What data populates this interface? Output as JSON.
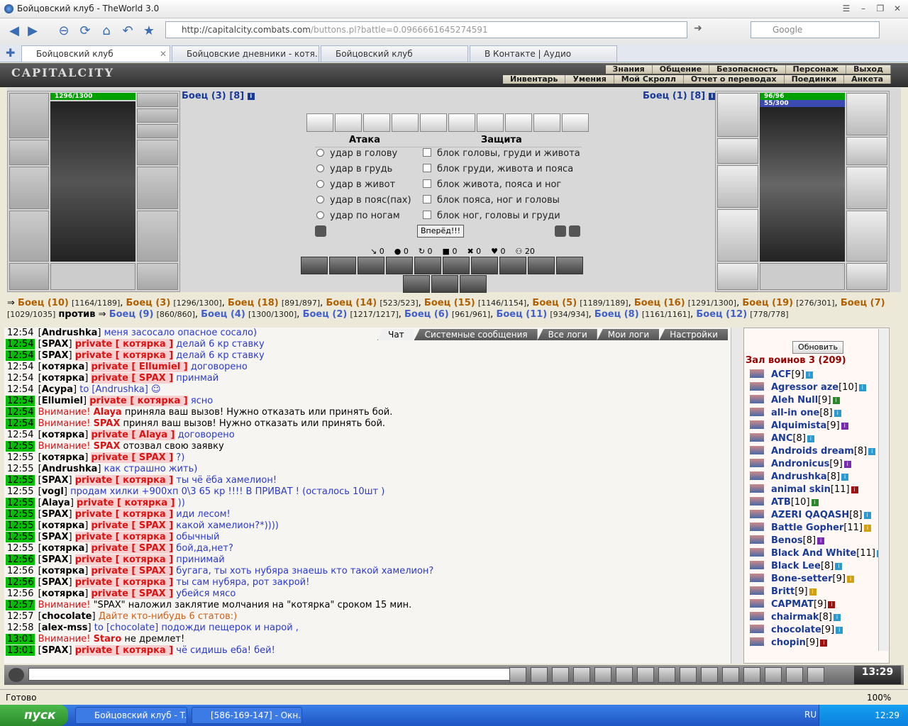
{
  "window": {
    "title": "Бойцовский клуб - TheWorld 3.0"
  },
  "address": {
    "host": "http://capitalcity.combats.com",
    "path": "/buttons.pl?battle=0.0966661645274591"
  },
  "search": {
    "placeholder": "Google"
  },
  "tabs": [
    {
      "label": "Бойцовский клуб"
    },
    {
      "label": "Бойцовские дневники - котя..."
    },
    {
      "label": "Бойцовский клуб"
    },
    {
      "label": "В Контакте | Аудио"
    }
  ],
  "site": {
    "logo": "CAPITALCITY",
    "menu_top": [
      "Знания",
      "Общение",
      "Безопасность",
      "Персонаж",
      "Выход"
    ],
    "menu_bottom": [
      "Инвентарь",
      "Умения",
      "Мой Скролл",
      "Отчет о переводах",
      "Поединки",
      "Анкета"
    ]
  },
  "battle": {
    "left": {
      "name": "Боец (3) [8]",
      "hp": "1296/1300"
    },
    "right": {
      "name": "Боец (1) [8]",
      "hp": "96/96",
      "mana": "55/300"
    },
    "attack_title": "Атака",
    "defense_title": "Защита",
    "attacks": [
      "удар в голову",
      "удар в грудь",
      "удар в живот",
      "удар в пояс(пах)",
      "удар по ногам"
    ],
    "blocks": [
      "блок головы, груди и живота",
      "блок груди, живота и пояса",
      "блок живота, пояса и ног",
      "блок пояса, ног и головы",
      "блок ног, головы и груди"
    ],
    "go_button": "Вперёд!!!",
    "counters": [
      "0",
      "0",
      "0",
      "0",
      "0",
      "0",
      "20"
    ],
    "versus": "против"
  },
  "team_a": [
    [
      "Боец (10)",
      "[1164/1189]"
    ],
    [
      "Боец (3)",
      "[1296/1300]"
    ],
    [
      "Боец (18)",
      "[891/897]"
    ],
    [
      "Боец (14)",
      "[523/523]"
    ],
    [
      "Боец (15)",
      "[1146/1154]"
    ],
    [
      "Боец (5)",
      "[1189/1189]"
    ],
    [
      "Боец (16)",
      "[1291/1300]"
    ],
    [
      "Боец (19)",
      "[276/301]"
    ],
    [
      "Боец (7)",
      "[1029/1035]"
    ]
  ],
  "team_b": [
    [
      "Боец (9)",
      "[860/860]"
    ],
    [
      "Боец (4)",
      "[1300/1300]"
    ],
    [
      "Боец (2)",
      "[1217/1217]"
    ],
    [
      "Боец (6)",
      "[961/961]"
    ],
    [
      "Боец (11)",
      "[934/934]"
    ],
    [
      "Боец (8)",
      "[1161/1161]"
    ],
    [
      "Боец (12)",
      "[778/778]"
    ]
  ],
  "chat_tabs": [
    "Чат",
    "Системные сообщения",
    "Все логи",
    "Мои логи",
    "Настройки"
  ],
  "chat": [
    {
      "t": "12:54",
      "g": false,
      "nick": "Andrushka",
      "pv": "",
      "msg": "меня засосало опасное сосало)",
      "mc": "ms"
    },
    {
      "t": "12:54",
      "g": true,
      "nick": "SPAX",
      "pv": "private [ котярка ]",
      "msg": "делай 6 кр ставку",
      "mc": "ms"
    },
    {
      "t": "12:54",
      "g": true,
      "nick": "SPAX",
      "pv": "private [ котярка ]",
      "msg": "делай 6 кр ставку",
      "mc": "ms"
    },
    {
      "t": "12:54",
      "g": false,
      "nick": "котярка",
      "pv": "private [ Ellumiel ]",
      "msg": "договорено",
      "mc": "ms"
    },
    {
      "t": "12:54",
      "g": false,
      "nick": "котярка",
      "pv": "private [ SPAX ]",
      "msg": "принмай",
      "mc": "ms"
    },
    {
      "t": "12:54",
      "g": false,
      "nick": "Acypa",
      "pv": "",
      "msg": "to [Andrushka] ☺",
      "mc": "ms"
    },
    {
      "t": "12:54",
      "g": true,
      "nick": "Ellumiel",
      "pv": "private [ котярка ]",
      "msg": "ясно",
      "mc": "ms"
    },
    {
      "t": "12:54",
      "g": true,
      "warn": "Внимание!",
      "who": "Alaya",
      "text": "приняла ваш вызов! Нужно отказать или принять бой."
    },
    {
      "t": "12:54",
      "g": true,
      "warn": "Внимание!",
      "who": "SPAX",
      "text": "принял ваш вызов! Нужно отказать или принять бой."
    },
    {
      "t": "12:54",
      "g": false,
      "nick": "котярка",
      "pv": "private [ Alaya ]",
      "msg": "договорено",
      "mc": "ms"
    },
    {
      "t": "12:55",
      "g": true,
      "warn": "Внимание!",
      "who": "SPAX",
      "text": "отозвал свою заявку"
    },
    {
      "t": "12:55",
      "g": false,
      "nick": "котярка",
      "pv": "private [ SPAX ]",
      "msg": "?)",
      "mc": "ms"
    },
    {
      "t": "12:55",
      "g": false,
      "nick": "Andrushka",
      "pv": "",
      "msg": "как страшно жить)",
      "mc": "ms"
    },
    {
      "t": "12:55",
      "g": true,
      "nick": "SPAX",
      "pv": "private [ котярка ]",
      "msg": "ты чё ёба хамелион!",
      "mc": "ms"
    },
    {
      "t": "12:55",
      "g": false,
      "nick": "vogl",
      "pv": "",
      "msg": "продам хилки +900хп 0\\3 65 кр !!!! В ПРИВАТ ! (осталось 10шт )",
      "mc": "ms"
    },
    {
      "t": "12:55",
      "g": true,
      "nick": "Alaya",
      "pv": "private [ котярка ]",
      "msg": "))",
      "mc": "ms"
    },
    {
      "t": "12:55",
      "g": true,
      "nick": "SPAX",
      "pv": "private [ котярка ]",
      "msg": "иди лесом!",
      "mc": "ms"
    },
    {
      "t": "12:55",
      "g": true,
      "nick": "котярка",
      "pv": "private [ SPAX ]",
      "msg": "какой хамелион?*))))",
      "mc": "ms"
    },
    {
      "t": "12:55",
      "g": true,
      "nick": "SPAX",
      "pv": "private [ котярка ]",
      "msg": "обычный",
      "mc": "ms"
    },
    {
      "t": "12:55",
      "g": false,
      "nick": "котярка",
      "pv": "private [ SPAX ]",
      "msg": "бой,да,нет?",
      "mc": "ms"
    },
    {
      "t": "12:56",
      "g": true,
      "nick": "SPAX",
      "pv": "private [ котярка ]",
      "msg": "принимай",
      "mc": "ms"
    },
    {
      "t": "12:56",
      "g": false,
      "nick": "котярка",
      "pv": "private [ SPAX ]",
      "msg": "бугага, ты хоть нубяра знаешь кто такой хамелион?",
      "mc": "ms"
    },
    {
      "t": "12:56",
      "g": true,
      "nick": "SPAX",
      "pv": "private [ котярка ]",
      "msg": "ты сам нубяра, рот закрой!",
      "mc": "ms"
    },
    {
      "t": "12:56",
      "g": false,
      "nick": "котярка",
      "pv": "private [ SPAX ]",
      "msg": "убейся мясо",
      "mc": "ms"
    },
    {
      "t": "12:57",
      "g": true,
      "warn": "Внимание!",
      "who": "",
      "text": "\"SPAX\" наложил заклятие молчания на \"котярка\" сроком 15 мин."
    },
    {
      "t": "12:57",
      "g": false,
      "nick": "chocolate",
      "pv": "",
      "msg": "Дайте кто-нибудь 6 статов:)",
      "mc": "ann"
    },
    {
      "t": "12:58",
      "g": false,
      "nick": "alex-mss",
      "pv": "",
      "msg": "to [chocolate] подожди пещерок и нарой ,",
      "mc": "ms"
    },
    {
      "t": "13:01",
      "g": true,
      "warn": "Внимание!",
      "who": "Staro",
      "text": "не дремлет!"
    },
    {
      "t": "13:01",
      "g": true,
      "nick": "SPAX",
      "pv": "private [ котярка ]",
      "msg": "чё сидишь еба! бей!",
      "mc": "ms"
    }
  ],
  "users": {
    "refresh": "Обновить",
    "room": "Зал воинов 3 (209)",
    "list": [
      [
        "ACF",
        "[9]",
        "#2a9ad0"
      ],
      [
        "Agressor aze",
        "[10]",
        "#2a9ad0"
      ],
      [
        "Aleh Null",
        "[9]",
        "#2a8a2a"
      ],
      [
        "all-in one",
        "[8]",
        "#2a9ad0"
      ],
      [
        "Alquimista",
        "[9]",
        "#7a2ab0"
      ],
      [
        "ANC",
        "[8]",
        "#2a9ad0"
      ],
      [
        "Androids dream",
        "[8]",
        "#2a9ad0"
      ],
      [
        "Andronicus",
        "[9]",
        "#7a2ab0"
      ],
      [
        "Andrushka",
        "[8]",
        "#2a9ad0"
      ],
      [
        "animal skin",
        "[11]",
        "#a01010"
      ],
      [
        "ATB",
        "[10]",
        "#2a8a2a"
      ],
      [
        "AZERI QAQASH",
        "[8]",
        "#2a9ad0"
      ],
      [
        "Battle Gopher",
        "[11]",
        "#d0a010"
      ],
      [
        "Benos",
        "[8]",
        "#7a2ab0"
      ],
      [
        "Black And White",
        "[11]",
        "#2a9ad0"
      ],
      [
        "Black Lee",
        "[8]",
        "#2a9ad0"
      ],
      [
        "Bone-setter",
        "[9]",
        "#d0a010"
      ],
      [
        "Britt",
        "[9]",
        "#d0a010"
      ],
      [
        "CAPMAT",
        "[9]",
        "#a01010"
      ],
      [
        "chairmak",
        "[8]",
        "#2a9ad0"
      ],
      [
        "chocolate",
        "[9]",
        "#2a9ad0"
      ],
      [
        "chopin",
        "[9]",
        "#a01010"
      ]
    ]
  },
  "clock": {
    "time": "13:29"
  },
  "status": {
    "text": "Готово",
    "zoom": "100%"
  },
  "taskbar": {
    "start": "пуск",
    "items": [
      "Бойцовский клуб - T...",
      "[586-169-147] - Окн..."
    ],
    "lang": "RU",
    "time": "12:29"
  }
}
